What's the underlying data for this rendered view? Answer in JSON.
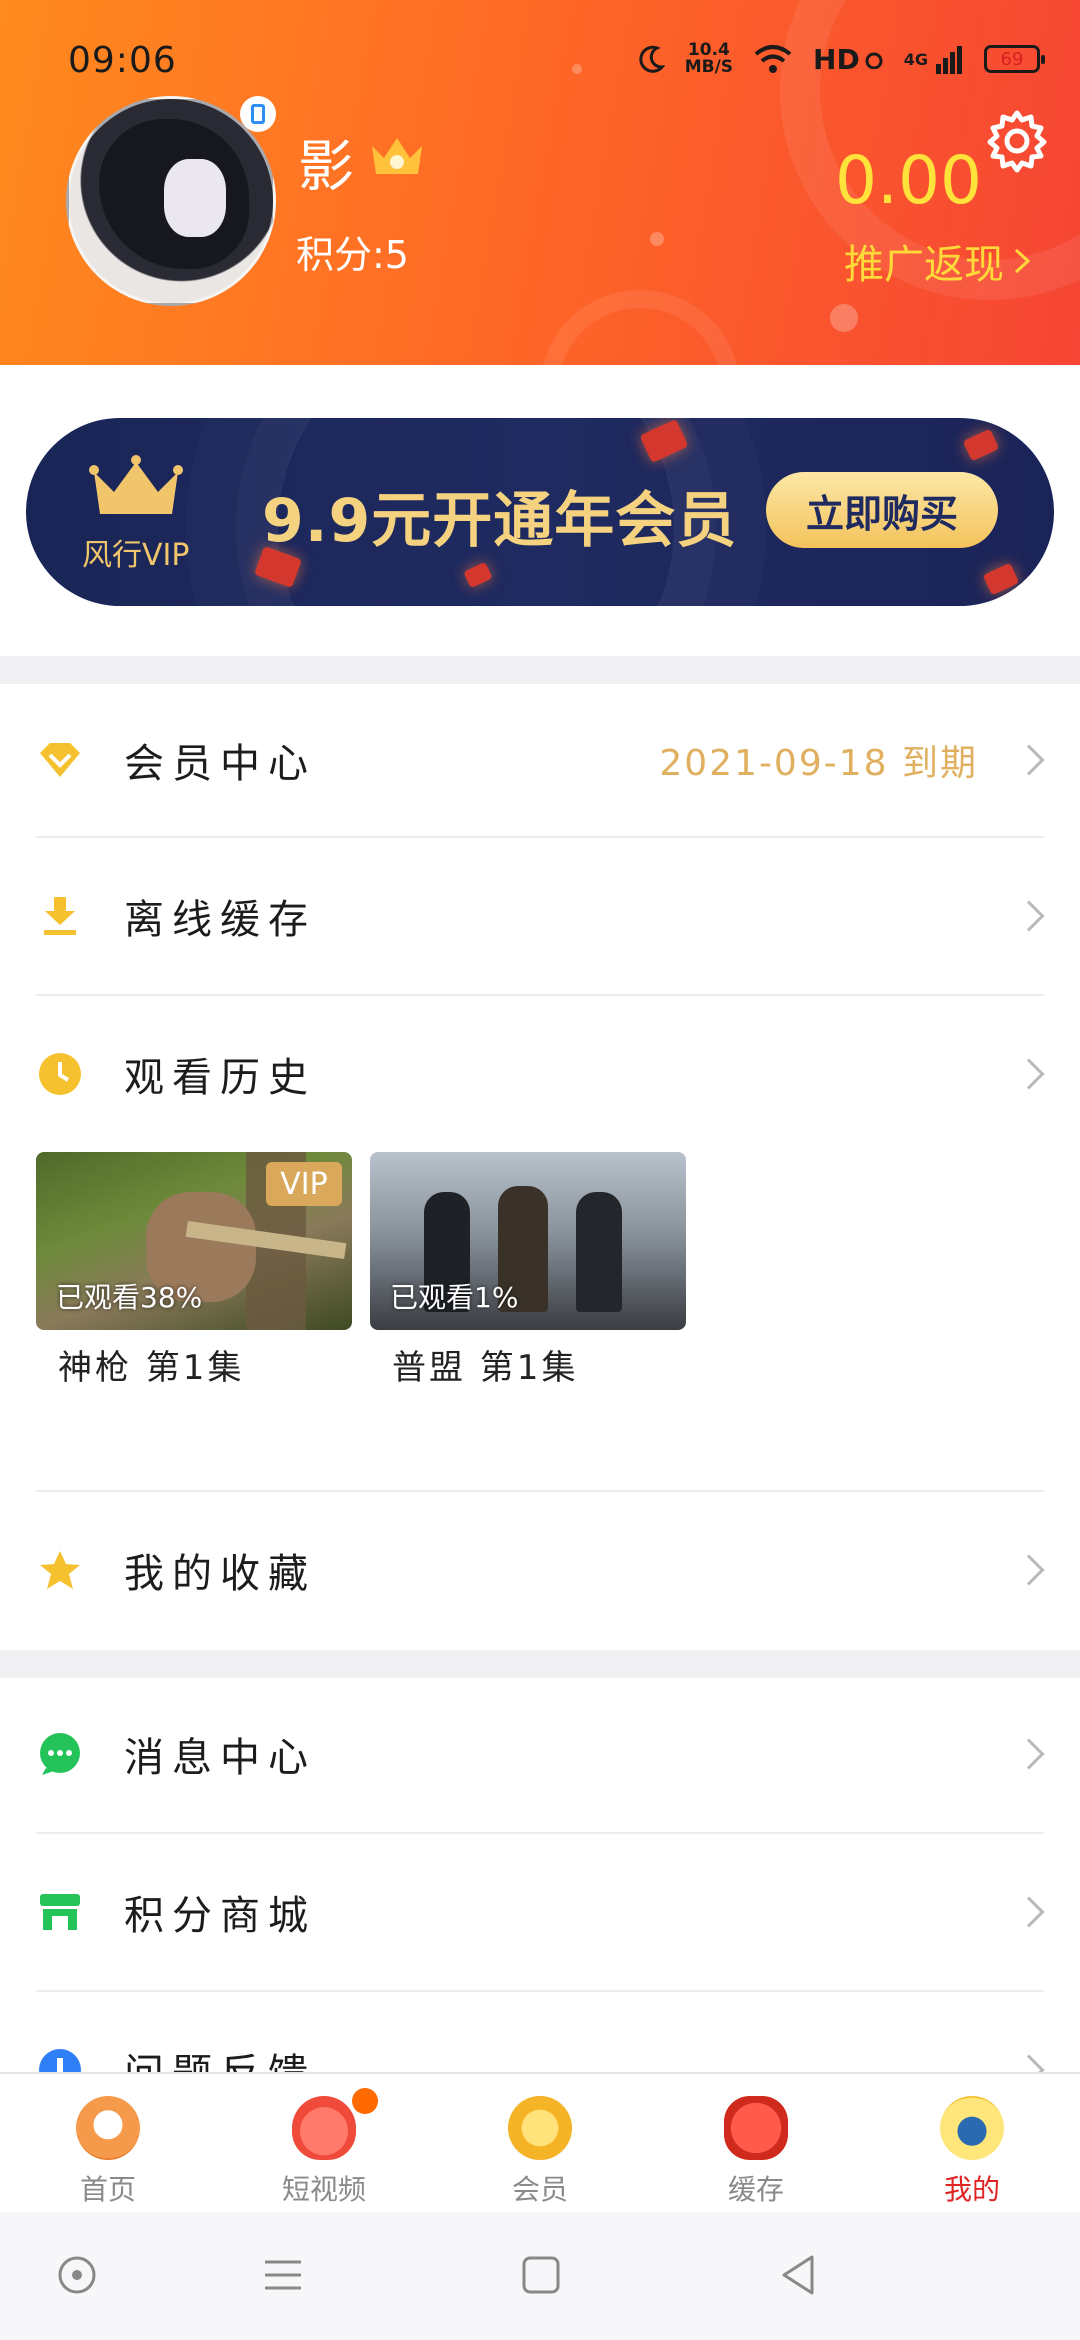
{
  "status_bar": {
    "time": "09:06",
    "speed_value": "10.4",
    "speed_unit": "MB/S",
    "network_hd": "HD",
    "network_gen": "4G",
    "battery": "69"
  },
  "profile": {
    "username": "影",
    "points": "积分:5",
    "balance": "0.00",
    "promo_link": "推广返现"
  },
  "banner": {
    "vip_label": "风行VIP",
    "title": "9.9元开通年会员",
    "button": "立即购买"
  },
  "menu": {
    "member_center": {
      "label": "会员中心",
      "expiry": "2021-09-18 到期"
    },
    "offline_cache": {
      "label": "离线缓存"
    },
    "watch_history": {
      "label": "观看历史"
    },
    "favorites": {
      "label": "我的收藏"
    },
    "messages": {
      "label": "消息中心"
    },
    "points_mall": {
      "label": "积分商城"
    },
    "feedback": {
      "label": "问题反馈"
    }
  },
  "history": [
    {
      "title": "神枪 第1集",
      "progress": "已观看38%",
      "tag": "VIP"
    },
    {
      "title": "普盟 第1集",
      "progress": "已观看1%"
    }
  ],
  "tabs": [
    {
      "label": "首页"
    },
    {
      "label": "短视频"
    },
    {
      "label": "会员"
    },
    {
      "label": "缓存"
    },
    {
      "label": "我的"
    }
  ],
  "colors": {
    "header_start": "#ff8a1e",
    "header_end": "#f64534",
    "accent_gold": "#f5d27f",
    "active_tab": "#e02424"
  },
  "icons": [
    "crown-icon",
    "gear-icon",
    "diamond-icon",
    "download-icon",
    "clock-icon",
    "star-icon",
    "chat-icon",
    "store-icon",
    "info-icon"
  ]
}
